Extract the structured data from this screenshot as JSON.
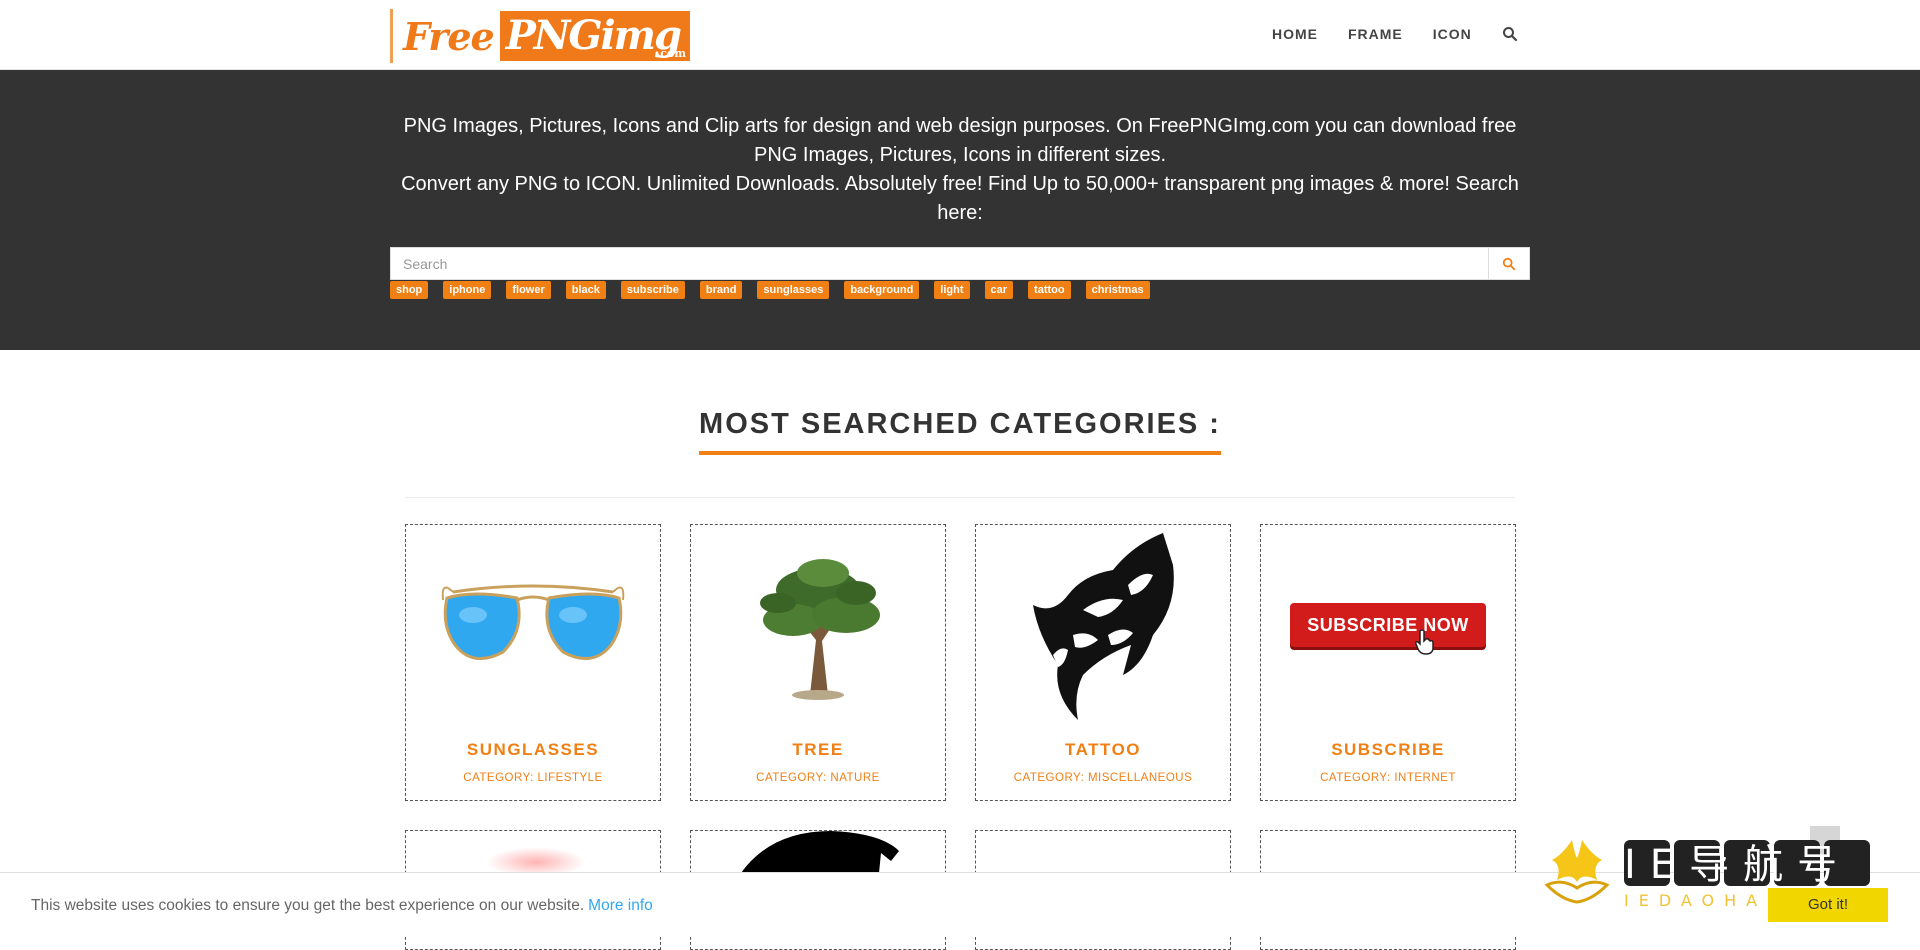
{
  "header": {
    "logo": {
      "free": "Free",
      "png": "PNGimg",
      "dotcom": ".com"
    },
    "nav": [
      "HOME",
      "FRAME",
      "ICON"
    ],
    "search_icon": "search-icon"
  },
  "hero": {
    "line1": "PNG Images, Pictures, Icons and Clip arts for design and web design purposes. On FreePNGImg.com you can download free PNG Images, Pictures, Icons in different sizes.",
    "line2": "Convert any PNG to ICON. Unlimited Downloads. Absolutely free! Find Up to 50,000+ transparent png images & more! Search here:",
    "search_placeholder": "Search",
    "search_button_icon": "search-icon",
    "tags": [
      "shop",
      "iphone",
      "flower",
      "black",
      "subscribe",
      "brand",
      "sunglasses",
      "background",
      "light",
      "car",
      "tattoo",
      "christmas"
    ]
  },
  "section": {
    "title": "MOST SEARCHED CATEGORIES :"
  },
  "cards": [
    {
      "title": "SUNGLASSES",
      "category": "CATEGORY: LIFESTYLE",
      "icon": "sunglasses-image"
    },
    {
      "title": "TREE",
      "category": "CATEGORY: NATURE",
      "icon": "tree-image"
    },
    {
      "title": "TATTOO",
      "category": "CATEGORY: MISCELLANEOUS",
      "icon": "wolf-tattoo-image"
    },
    {
      "title": "SUBSCRIBE",
      "category": "CATEGORY: INTERNET",
      "icon": "subscribe-button-image",
      "button_text": "SUBSCRIBE NOW"
    }
  ],
  "cookie": {
    "text": "This website uses cookies to ensure you get the best experience on our website.",
    "link": "More info",
    "button": "Got it!"
  },
  "watermark": {
    "text": "IE导航号",
    "sub": "IEDAOHA"
  },
  "colors": {
    "accent": "#f07f14",
    "hero_bg": "#333333",
    "cookie_button": "#f1d600",
    "link": "#31a8f0"
  }
}
